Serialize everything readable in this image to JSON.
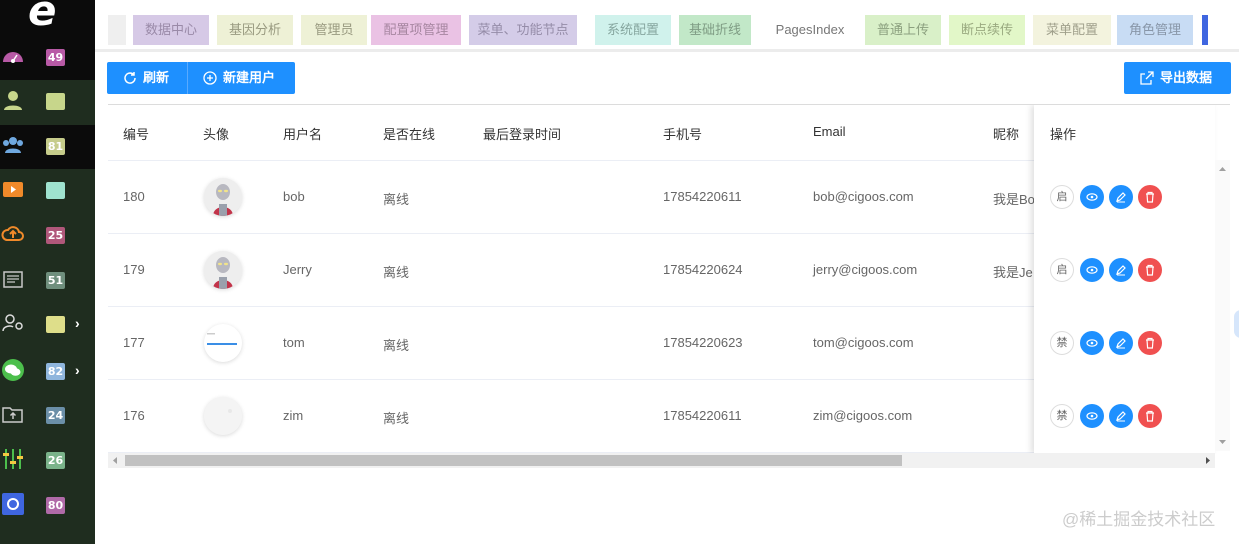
{
  "sidebar": {
    "logo": "e",
    "items": [
      {
        "icon": "dashboard-gauge-icon",
        "badge": "49",
        "badge_color": "#b85aa6",
        "active": true,
        "has_arrow": false
      },
      {
        "icon": "user-icon",
        "badge": "",
        "badge_color": "#c7d68b",
        "active": false,
        "has_arrow": false
      },
      {
        "icon": "users-group-icon",
        "badge": "81",
        "badge_color": "#c6cc8b",
        "active": true,
        "has_arrow": false
      },
      {
        "icon": "video-play-icon",
        "badge": "",
        "badge_color": "#9fe3cf",
        "active": false,
        "has_arrow": false
      },
      {
        "icon": "cloud-upload-icon",
        "badge": "25",
        "badge_color": "#b0577a",
        "active": false,
        "has_arrow": false
      },
      {
        "icon": "newspaper-icon",
        "badge": "51",
        "badge_color": "#6f8f7d",
        "active": false,
        "has_arrow": false
      },
      {
        "icon": "user-location-icon",
        "badge": "",
        "badge_color": "#dede8a",
        "active": false,
        "has_arrow": true
      },
      {
        "icon": "wechat-icon",
        "badge": "82",
        "badge_color": "#8fb6dd",
        "active": false,
        "has_arrow": true
      },
      {
        "icon": "folder-upload-icon",
        "badge": "24",
        "badge_color": "#6b8fa8",
        "active": false,
        "has_arrow": false
      },
      {
        "icon": "sliders-icon",
        "badge": "26",
        "badge_color": "#7ab38a",
        "active": false,
        "has_arrow": false
      },
      {
        "icon": "settings-panel-icon",
        "badge": "80",
        "badge_color": "#b06aa8",
        "active": false,
        "has_arrow": false
      }
    ]
  },
  "tabs": [
    {
      "label": "数据中心",
      "bg": "#d6c9e6",
      "color": "#9a8aa8"
    },
    {
      "label": "基因分析",
      "bg": "#eef1d6",
      "color": "#999a80"
    },
    {
      "label": "管理员",
      "bg": "#eef1d6",
      "color": "#999a80"
    },
    {
      "label": "配置项管理",
      "bg": "#eac2e4",
      "color": "#a686a0"
    },
    {
      "label": "菜单、功能节点",
      "bg": "#d4cce8",
      "color": "#958ca8"
    },
    {
      "label": "系统配置",
      "bg": "#d0f2ec",
      "color": "#86a69f"
    },
    {
      "label": "基础折线",
      "bg": "#c2e8c8",
      "color": "#7f9c84"
    },
    {
      "label": "PagesIndex",
      "bg": "#ffffff",
      "color": "#777777"
    },
    {
      "label": "普通上传",
      "bg": "#d9f0c8",
      "color": "#8ca07f"
    },
    {
      "label": "断点续传",
      "bg": "#e2f7c8",
      "color": "#9aaa80"
    },
    {
      "label": "菜单配置",
      "bg": "#f3f3de",
      "color": "#a0a08c"
    },
    {
      "label": "角色管理",
      "bg": "#c8dcf4",
      "color": "#8896a8"
    }
  ],
  "toolbar": {
    "refresh_label": "刷新",
    "new_user_label": "新建用户",
    "export_label": "导出数据"
  },
  "table": {
    "columns": {
      "id": "编号",
      "avatar": "头像",
      "username": "用户名",
      "online": "是否在线",
      "last_login": "最后登录时间",
      "phone": "手机号",
      "email": "Email",
      "nickname": "昵称",
      "actions": "操作"
    },
    "rows": [
      {
        "id": "180",
        "avatar": "ultraman",
        "username": "bob",
        "online": "离线",
        "last_login": "",
        "phone": "17854220611",
        "email": "bob@cigoos.com",
        "nickname": "我是Bo",
        "status_btn": "启"
      },
      {
        "id": "179",
        "avatar": "ultraman",
        "username": "Jerry",
        "online": "离线",
        "last_login": "",
        "phone": "17854220624",
        "email": "jerry@cigoos.com",
        "nickname": "我是Je",
        "status_btn": "启"
      },
      {
        "id": "177",
        "avatar": "blank-screenshot",
        "username": "tom",
        "online": "离线",
        "last_login": "",
        "phone": "17854220623",
        "email": "tom@cigoos.com",
        "nickname": "",
        "status_btn": "禁"
      },
      {
        "id": "176",
        "avatar": "blank-light",
        "username": "zim",
        "online": "离线",
        "last_login": "",
        "phone": "17854220611",
        "email": "zim@cigoos.com",
        "nickname": "",
        "status_btn": "禁"
      }
    ]
  },
  "watermark": "@稀土掘金技术社区"
}
